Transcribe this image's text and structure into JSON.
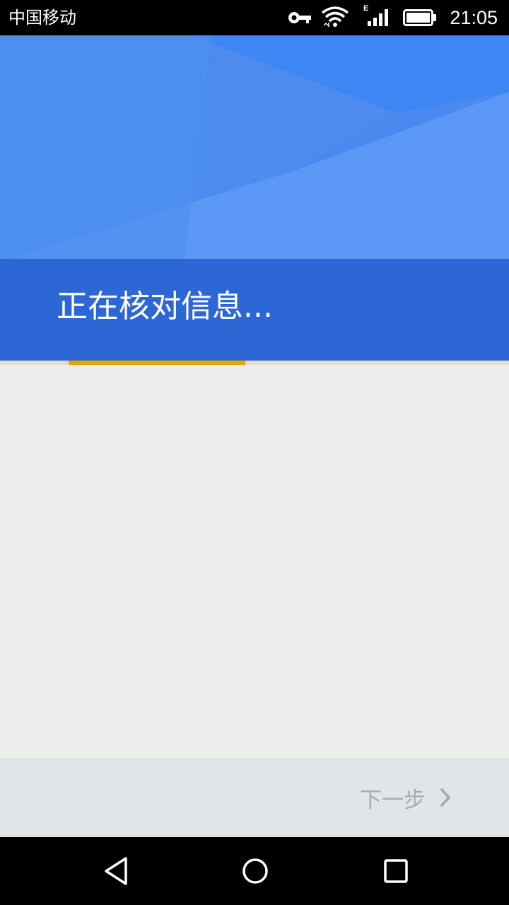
{
  "status_bar": {
    "carrier": "中国移动",
    "network_type": "E",
    "time": "21:05",
    "icons": [
      "vpn-key-icon",
      "wifi-icon",
      "cellular-signal-icon",
      "battery-icon"
    ]
  },
  "header": {
    "title": "正在核对信息..."
  },
  "progress": {
    "state": "indeterminate"
  },
  "footer": {
    "next_label": "下一步",
    "next_icon": "chevron-right-icon"
  },
  "nav_bar": {
    "icons": [
      "back-icon",
      "home-icon",
      "recents-icon"
    ]
  },
  "colors": {
    "header_blue": "#3f85ee",
    "band_blue": "#2d67d6",
    "progress_amber": "#e8a400",
    "background": "#eeeeec",
    "footer_bg": "#e1e5e8",
    "disabled_text": "#a9adb1"
  }
}
